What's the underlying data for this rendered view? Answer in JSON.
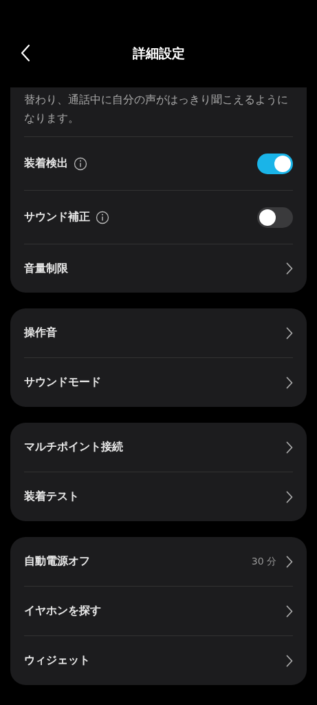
{
  "header": {
    "title": "詳細設定"
  },
  "sections": [
    {
      "note": "替わり、通話中に自分の声がはっきり聞こえるようになります。",
      "items": [
        {
          "kind": "toggle",
          "label": "装着検出",
          "info": true,
          "on": true
        },
        {
          "kind": "toggle",
          "label": "サウンド補正",
          "info": true,
          "on": false
        },
        {
          "kind": "link",
          "label": "音量制限"
        }
      ]
    },
    {
      "items": [
        {
          "kind": "link",
          "label": "操作音"
        },
        {
          "kind": "link",
          "label": "サウンドモード"
        }
      ]
    },
    {
      "items": [
        {
          "kind": "link",
          "label": "マルチポイント接続"
        },
        {
          "kind": "link",
          "label": "装着テスト"
        }
      ]
    },
    {
      "items": [
        {
          "kind": "link",
          "label": "自動電源オフ",
          "value": "30 分"
        },
        {
          "kind": "link",
          "label": "イヤホンを探す"
        },
        {
          "kind": "link",
          "label": "ウィジェット"
        }
      ]
    }
  ]
}
